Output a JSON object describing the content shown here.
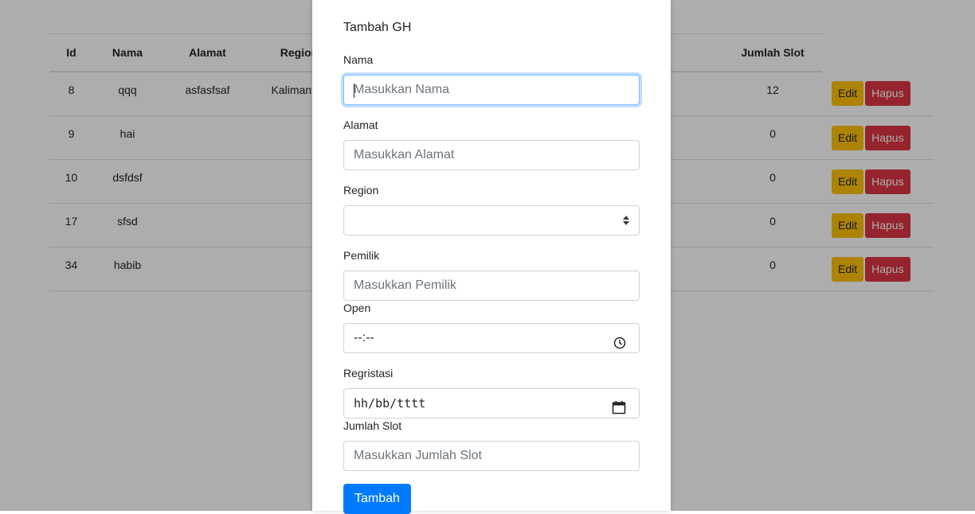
{
  "table": {
    "headers": [
      "Id",
      "Nama",
      "Alamat",
      "Region",
      "",
      "",
      "",
      "",
      "Jumlah Slot"
    ],
    "rows": [
      {
        "id": "8",
        "nama": "qqq",
        "alamat": "asfasfsaf",
        "region": "Kalimantan",
        "jumlah_slot": "12"
      },
      {
        "id": "9",
        "nama": "hai",
        "alamat": "",
        "region": "",
        "jumlah_slot": "0"
      },
      {
        "id": "10",
        "nama": "dsfdsf",
        "alamat": "",
        "region": "",
        "jumlah_slot": "0"
      },
      {
        "id": "17",
        "nama": "sfsd",
        "alamat": "",
        "region": "",
        "jumlah_slot": "0"
      },
      {
        "id": "34",
        "nama": "habib",
        "alamat": "",
        "region": "",
        "jumlah_slot": "0"
      }
    ],
    "edit_label": "Edit",
    "hapus_label": "Hapus"
  },
  "modal": {
    "title": "Tambah GH",
    "nama_label": "Nama",
    "nama_placeholder": "Masukkan Nama",
    "alamat_label": "Alamat",
    "alamat_placeholder": "Masukkan Alamat",
    "region_label": "Region",
    "region_value": "",
    "pemilik_label": "Pemilik",
    "pemilik_placeholder": "Masukkan Pemilik",
    "open_label": "Open",
    "open_value": "--:--",
    "registrasi_label": "Regristasi",
    "registrasi_value": "hh/bb/tttt",
    "jumlah_slot_label": "Jumlah Slot",
    "jumlah_slot_placeholder": "Masukkan Jumlah Slot",
    "submit_label": "Tambah"
  },
  "colors": {
    "primary": "#007bff",
    "warning": "#ffc107",
    "danger": "#dc3545",
    "focus_border": "#80bdff"
  },
  "icons": [
    "select-arrows-icon",
    "clock-icon",
    "calendar-icon"
  ]
}
